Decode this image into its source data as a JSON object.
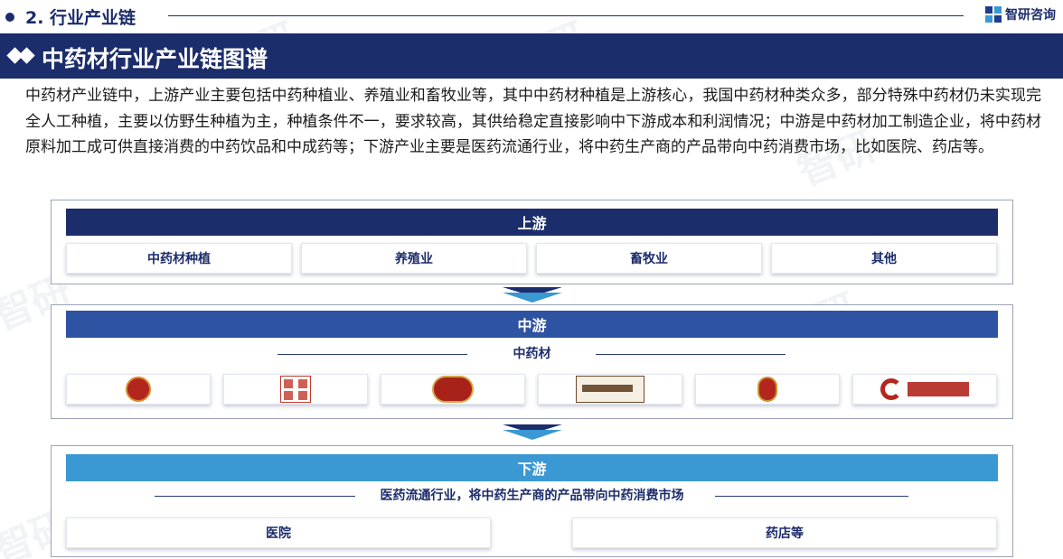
{
  "section": {
    "title": "2. 行业产业链",
    "logo_text": "智研咨询"
  },
  "titlebar": {
    "title": "中药材行业产业链图谱"
  },
  "description": "中药材产业链中，上游产业主要包括中药种植业、养殖业和畜牧业等，其中中药材种植是上游核心，我国中药材种类众多，部分特殊中药材仍未实现完全人工种植，主要以仿野生种植为主，种植条件不一，要求较高，其供给稳定直接影响中下游成本和利润情况；中游是中药材加工制造企业，将中药材原料加工成可供直接消费的中药饮品和中成药等；下游产业主要是医药流通行业，将中药生产商的产品带向中药消费市场，比如医院、药店等。",
  "upstream": {
    "label": "上游",
    "items": [
      "中药材种植",
      "养殖业",
      "畜牧业",
      "其他"
    ]
  },
  "midstream": {
    "label": "中游",
    "sub_label": "中药材",
    "brand_logos": [
      "brand-logo-1",
      "brand-logo-2",
      "brand-logo-3",
      "brand-logo-4",
      "brand-logo-5",
      "brand-logo-6"
    ]
  },
  "downstream": {
    "label": "下游",
    "sub_label": "医药流通行业，将中药生产商的产品带向中药消费市场",
    "items": [
      "医院",
      "药店等"
    ]
  },
  "colors": {
    "navy": "#1c2d6c",
    "mid_blue": "#2f53a3",
    "light_blue": "#3a98d2"
  }
}
